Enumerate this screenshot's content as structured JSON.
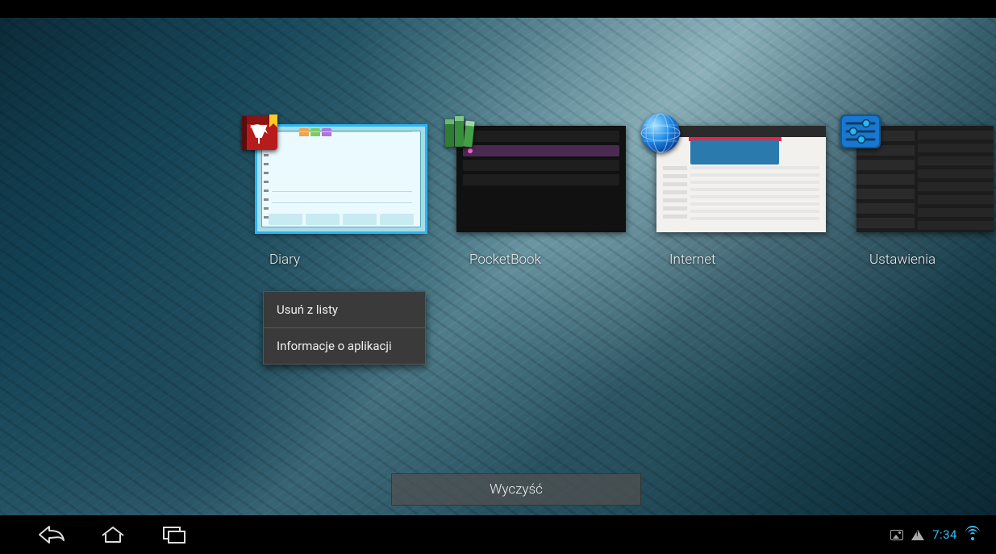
{
  "recents": [
    {
      "label": "Diary"
    },
    {
      "label": "PocketBook"
    },
    {
      "label": "Internet"
    },
    {
      "label": "Ustawienia"
    }
  ],
  "context_menu": {
    "remove": "Usuń z listy",
    "app_info": "Informacje o aplikacji"
  },
  "clear_button": "Wyczyść",
  "status": {
    "time": "7:34"
  }
}
